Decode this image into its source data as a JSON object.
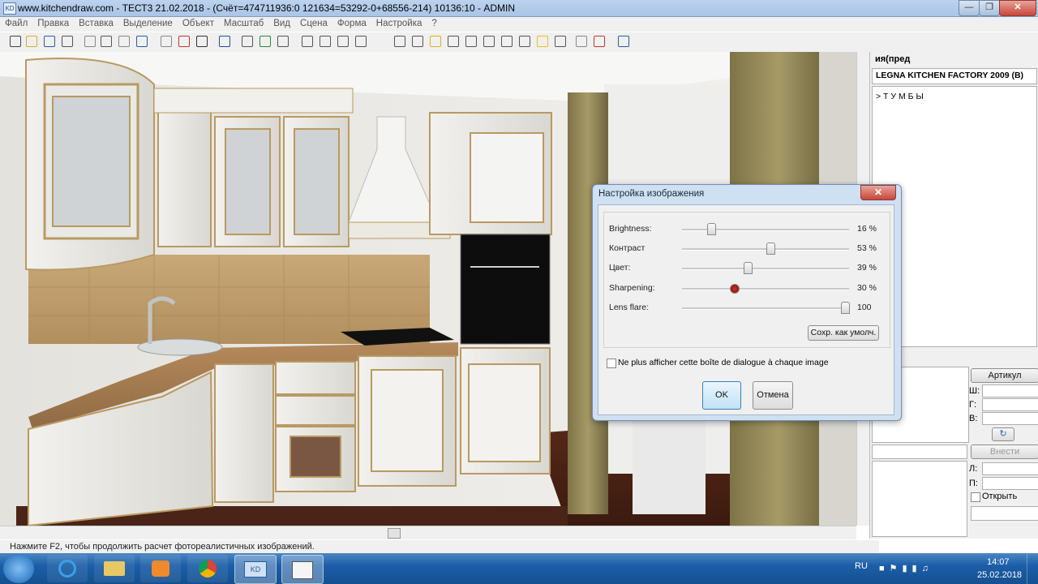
{
  "window": {
    "title": "www.kitchendraw.com - ТЕСТ3 21.02.2018 - (Счёт=474711936:0 121634=53292-0+68556-214) 10136:10 - ADMIN"
  },
  "menu": [
    "Файл",
    "Правка",
    "Вставка",
    "Выделение",
    "Объект",
    "Масштаб",
    "Вид",
    "Сцена",
    "Форма",
    "Настройка",
    "?"
  ],
  "status_text": "Нажмите F2, чтобы продолжить расчет фотореалистичных изображений.",
  "right_panel": {
    "tab_label": "ия(пред",
    "catalog": "LEGNA KITCHEN FACTORY 2009 (B)",
    "category": "> Т У М Б Ы",
    "article_label": "Артикул",
    "w_label": "Ш:",
    "h_label": "Г:",
    "d_label": "В:",
    "insert_button": "Внести",
    "l_label": "Л:",
    "p_label": "П:",
    "open_checkbox_label": "Открыть"
  },
  "dialog": {
    "title": "Настройка изображения",
    "close_icon": "close-icon",
    "sliders": [
      {
        "label": "Brightness:",
        "value_text": "16 %",
        "level": 0.16
      },
      {
        "label": "Контраст",
        "value_text": "53 %",
        "level": 0.53
      },
      {
        "label": "Цвет:",
        "value_text": "39 %",
        "level": 0.39
      },
      {
        "label": "Sharpening:",
        "value_text": "30 %",
        "level": 0.3
      },
      {
        "label": "Lens flare:",
        "value_text": "100",
        "level": 1.0
      }
    ],
    "save_default_button": "Сохр. как умолч.",
    "checkbox_label": "Ne plus afficher cette boîte de dialogue à chaque image",
    "ok_button": "OK",
    "cancel_button": "Отмена"
  },
  "taskbar": {
    "language": "RU",
    "time": "14:07",
    "date": "25.02.2018"
  },
  "colors": {
    "accent": "#1c5ea8",
    "dialog_frame": "#cfe0f3",
    "slider_active": "#8b0000"
  }
}
